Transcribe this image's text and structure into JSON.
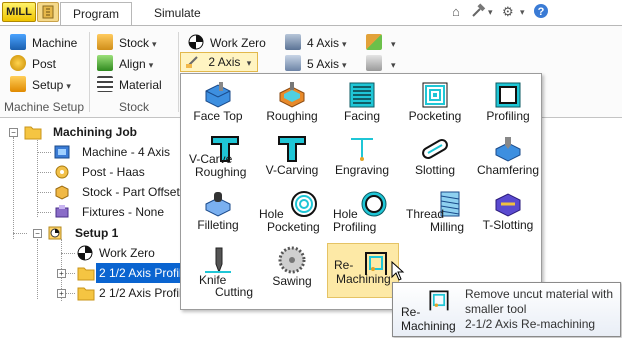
{
  "app": {
    "mill_label": "MILL"
  },
  "tabs": [
    {
      "label": "Program"
    },
    {
      "label": "Simulate"
    }
  ],
  "ribbon": {
    "groups": [
      {
        "label": "Machine Setup"
      },
      {
        "label": "Stock"
      }
    ],
    "machine_setup": {
      "machine": "Machine",
      "post": "Post",
      "setup": "Setup"
    },
    "stock": {
      "stock": "Stock",
      "align": "Align",
      "material": "Material"
    },
    "toolpath": {
      "work_zero": "Work Zero",
      "two_axis": "2 Axis",
      "four_axis": "4 Axis",
      "five_axis": "5 Axis"
    }
  },
  "tree": {
    "items": [
      {
        "label": "Machining Job"
      },
      {
        "label": "Machine - 4 Axis"
      },
      {
        "label": "Post - Haas"
      },
      {
        "label": "Stock - Part Offset"
      },
      {
        "label": "Fixtures - None"
      },
      {
        "label": "Setup 1"
      },
      {
        "label": "Work Zero"
      },
      {
        "label": "2 1/2 Axis Profil"
      },
      {
        "label": "2 1/2 Axis Profil"
      }
    ]
  },
  "gallery": {
    "items": [
      {
        "label": "Face Top"
      },
      {
        "label": "Roughing"
      },
      {
        "label": "Facing"
      },
      {
        "label": "Pocketing"
      },
      {
        "label": "Profiling"
      },
      {
        "label": "V-Carve",
        "label2": "Roughing"
      },
      {
        "label": "V-Carving"
      },
      {
        "label": "Engraving"
      },
      {
        "label": "Slotting"
      },
      {
        "label": "Chamfering"
      },
      {
        "label": "Filleting"
      },
      {
        "label": "Hole",
        "label2": "Pocketing"
      },
      {
        "label": "Hole",
        "label2": "Profiling"
      },
      {
        "label": "Thread",
        "label2": "Milling"
      },
      {
        "label": "T-Slotting"
      },
      {
        "label": "Knife",
        "label2": "Cutting"
      },
      {
        "label": "Sawing"
      },
      {
        "label": "Re-",
        "label2": "Machining"
      }
    ]
  },
  "tooltip": {
    "icon_label1": "Re-",
    "icon_label2": "Machining",
    "line1": "Remove uncut material with",
    "line2": "smaller tool",
    "line3": "2-1/2 Axis Re-machining"
  },
  "colors": {
    "accent_selection": "#0a64d0",
    "hover": "#fde9a6",
    "toolpath_cyan": "#1fc6d6",
    "mill_badge": "#f0c400"
  }
}
